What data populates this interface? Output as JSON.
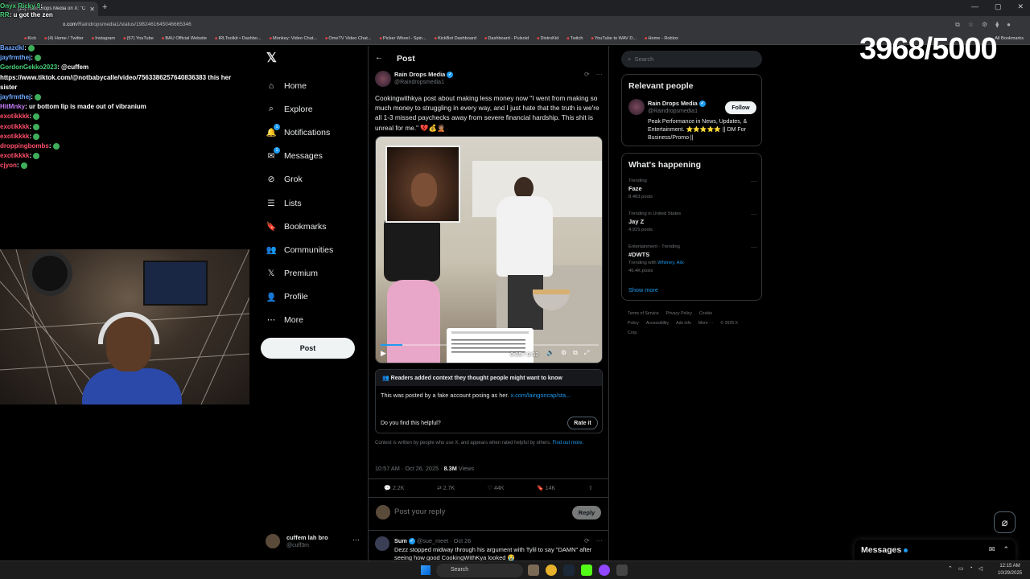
{
  "browser": {
    "tab_title": "(15) Rain Drops Media on X: \"C",
    "url_domain": "x.com",
    "url_path": "/Raindropsmedia1/status/1982461645046665346",
    "bookmarks": [
      "Kick",
      "(4) Home / Twitter",
      "Instagram",
      "(57) YouTube",
      "BAU Official Website",
      "IRLToolkit • Dashbo...",
      "Monkey: Video Chat...",
      "OmeTV Video Chat...",
      "Picker Wheel - Spin...",
      "KickBot Dashboard",
      "Dashboard - Pulsoid",
      "DistroKid",
      "Twitch",
      "YouTube to WAV D...",
      "Home - Roblox"
    ],
    "all_bookmarks": "All Bookmarks"
  },
  "chat": {
    "row1": {
      "user": "Onyx Ricky 9",
      "text": ""
    },
    "row2": {
      "user": "RR",
      "text": "u got the zen"
    },
    "lines": [
      {
        "user": "Baazdkl",
        "color": "#6fa8ff",
        "text": ""
      },
      {
        "user": "jayfrmthej",
        "color": "#6fa8ff",
        "text": ""
      },
      {
        "user": "GordonGekko2023",
        "color": "#49d17a",
        "text": "@cuffem"
      },
      {
        "user": "",
        "color": "#fff",
        "text": "https://www.tiktok.com/@notbabycalle/video/7563386257640836383 this her sister"
      },
      {
        "user": "jayfrmthej",
        "color": "#6fa8ff",
        "text": ""
      },
      {
        "user": "HitMnky",
        "color": "#c37cf7",
        "text": "ur bottom lip is made out of vibranium"
      },
      {
        "user": "exotikkkk",
        "color": "#ff4f6b",
        "text": ""
      },
      {
        "user": "exotikkkk",
        "color": "#ff4f6b",
        "text": ""
      },
      {
        "user": "exotikkkk",
        "color": "#ff4f6b",
        "text": ""
      },
      {
        "user": "droppingbombs",
        "color": "#ff4f6b",
        "text": ""
      },
      {
        "user": "exotikkkk",
        "color": "#ff4f6b",
        "text": ""
      },
      {
        "user": "cjyon",
        "color": "#ff4f6b",
        "text": ""
      }
    ]
  },
  "goal_counter": "3968/5000",
  "nav": {
    "items": [
      {
        "label": "Home",
        "icon": "home-icon"
      },
      {
        "label": "Explore",
        "icon": "search-icon"
      },
      {
        "label": "Notifications",
        "icon": "bell-icon",
        "badge": "1"
      },
      {
        "label": "Messages",
        "icon": "mail-icon",
        "badge": "1"
      },
      {
        "label": "Grok",
        "icon": "grok-icon"
      },
      {
        "label": "Lists",
        "icon": "list-icon"
      },
      {
        "label": "Bookmarks",
        "icon": "bookmark-icon"
      },
      {
        "label": "Communities",
        "icon": "people-icon"
      },
      {
        "label": "Premium",
        "icon": "x-logo-icon"
      },
      {
        "label": "Profile",
        "icon": "person-icon"
      },
      {
        "label": "More",
        "icon": "more-circle-icon"
      }
    ],
    "post_button": "Post",
    "account": {
      "name": "cuffem lah bro",
      "handle": "@cuff3m"
    }
  },
  "post": {
    "heading": "Post",
    "author_name": "Rain Drops Media",
    "author_handle": "@Raindropsmedia1",
    "text": "Cookingwithkya post about making less money now \"I went from making so much money to struggling in every way, and I just hate that the truth is we're all 1-3 missed paychecks away from severe financial hardship. This shit is unreal for me.\" 💔💰🤦🏽",
    "video": {
      "time": "0:05 / 0:52",
      "progress": 0.1,
      "embed_name": "CookingWithKya"
    },
    "community_note": {
      "header": "Readers added context they thought people might want to know",
      "body": "This was posted by a fake account posing as her.",
      "link": "x.com/laingoncap/sta...",
      "question": "Do you find this helpful?",
      "rate_button": "Rate it",
      "footer": "Context is written by people who use X, and appears when rated helpful by others.",
      "footer_link": "Find out more."
    },
    "timestamp": "10:57 AM · Oct 26, 2025 ·",
    "views": "8.3M",
    "views_label": "Views",
    "counts": {
      "replies": "2.2K",
      "reposts": "2.7K",
      "likes": "44K",
      "bookmarks": "14K"
    },
    "reply_placeholder": "Post your reply",
    "reply_button": "Reply"
  },
  "reply2": {
    "name": "Sum",
    "handle": "@sue_meet",
    "date": "Oct 26",
    "text": "Dezz stopped midway through his argument with Tylil to say \"DAMN\" after seeing how good CookingWithKya looked 😭"
  },
  "sidebar": {
    "search_placeholder": "Search",
    "relevant_title": "Relevant people",
    "relevant": {
      "name": "Rain Drops Media",
      "handle": "@Raindropsmedia1",
      "follow": "Follow",
      "bio": "Peak Performance in News, Updates, & Entertainment. ⭐⭐⭐⭐⭐ || DM For Business/Promo ||"
    },
    "happening_title": "What's happening",
    "trends": [
      {
        "category": "Trending",
        "name": "Faze",
        "count": "8,483 posts",
        "with": ""
      },
      {
        "category": "Trending in United States",
        "name": "Jay Z",
        "count": "4,915 posts",
        "with": ""
      },
      {
        "category": "Entertainment · Trending",
        "name": "#DWTS",
        "count": "46.4K posts",
        "with": "Whitney, Alix"
      }
    ],
    "show_more": "Show more",
    "footer": [
      "Terms of Service",
      "Privacy Policy",
      "Cookie Policy",
      "Accessibility",
      "Ads info",
      "More ···",
      "© 2025 X Corp."
    ]
  },
  "messages_drawer": {
    "title": "Messages"
  },
  "taskbar": {
    "search": "Search",
    "time": "12:15 AM",
    "date": "10/29/2025"
  }
}
